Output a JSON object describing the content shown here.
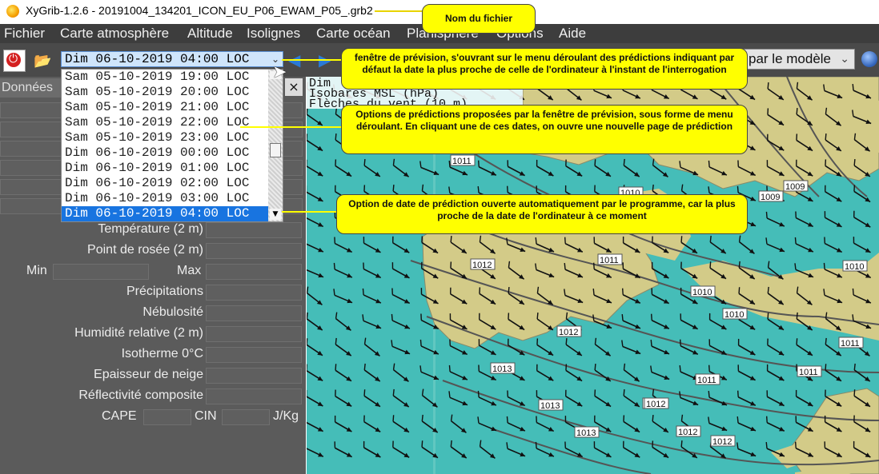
{
  "window": {
    "title": "XyGrib-1.2.6 - 20191004_134201_ICON_EU_P06_EWAM_P05_.grb2"
  },
  "menu": [
    "Fichier",
    "Carte atmosphère",
    "Altitude",
    "Isolignes",
    "Carte océan",
    "Planisphère",
    "Options",
    "Aide"
  ],
  "toolbar": {
    "date_value": "Dim 06-10-2019 04:00 LOC",
    "model_value": "par le modèle"
  },
  "panel": {
    "tab_label": "Données",
    "close_label": "×",
    "fields": {
      "temperature": "Température (2 m)",
      "dew_point": "Point de rosée (2 m)",
      "min": "Min",
      "max": "Max",
      "precip": "Précipitations",
      "cloud": "Nébulosité",
      "humidity": "Humidité relative (2 m)",
      "isotherm": "Isotherme 0°C",
      "snow": "Epaisseur de neige",
      "reflectivity": "Réflectivité composite",
      "cape": "CAPE",
      "cin": "CIN",
      "unit": "J/Kg"
    }
  },
  "dropdown": {
    "items": [
      "Sam 05-10-2019 19:00 LOC",
      "Sam 05-10-2019 20:00 LOC",
      "Sam 05-10-2019 21:00 LOC",
      "Sam 05-10-2019 22:00 LOC",
      "Sam 05-10-2019 23:00 LOC",
      "Dim 06-10-2019 00:00 LOC",
      "Dim 06-10-2019 01:00 LOC",
      "Dim 06-10-2019 02:00 LOC",
      "Dim 06-10-2019 03:00 LOC",
      "Dim 06-10-2019 04:00 LOC"
    ],
    "selected_index": 9
  },
  "map": {
    "header_line1": "Dim",
    "header_line2": "Isobares MSL (hPa)",
    "header_line3": "Flèches du vent (10 m)",
    "isobar_labels": [
      "1011",
      "1010",
      "1009",
      "1009",
      "1012",
      "1011",
      "1010",
      "1010",
      "1010",
      "1012",
      "1013",
      "1011",
      "1011",
      "1011",
      "1013",
      "1012",
      "1013",
      "1012",
      "1012",
      "1012"
    ],
    "colors": {
      "sea": "#45bdb8",
      "land": "#d3cb88",
      "isobar": "#555555",
      "arrow": "#111111"
    }
  },
  "callouts": {
    "filename": "Nom du fichier",
    "forecast_window": "fenêtre de prévision, s'ouvrant sur le menu déroulant des prédictions indiquant par défaut la date la plus proche de celle de l'ordinateur à l'instant de l'interrogation",
    "options": "Options de prédictions proposées par la fenêtre de prévision, sous forme de menu déroulant. En cliquant une de ces dates, on ouvre une nouvelle page de prédiction",
    "auto_option": "Option de date de prédiction ouverte automatiquement par le programme, car la plus proche de la date de l'ordinateur à ce moment"
  }
}
